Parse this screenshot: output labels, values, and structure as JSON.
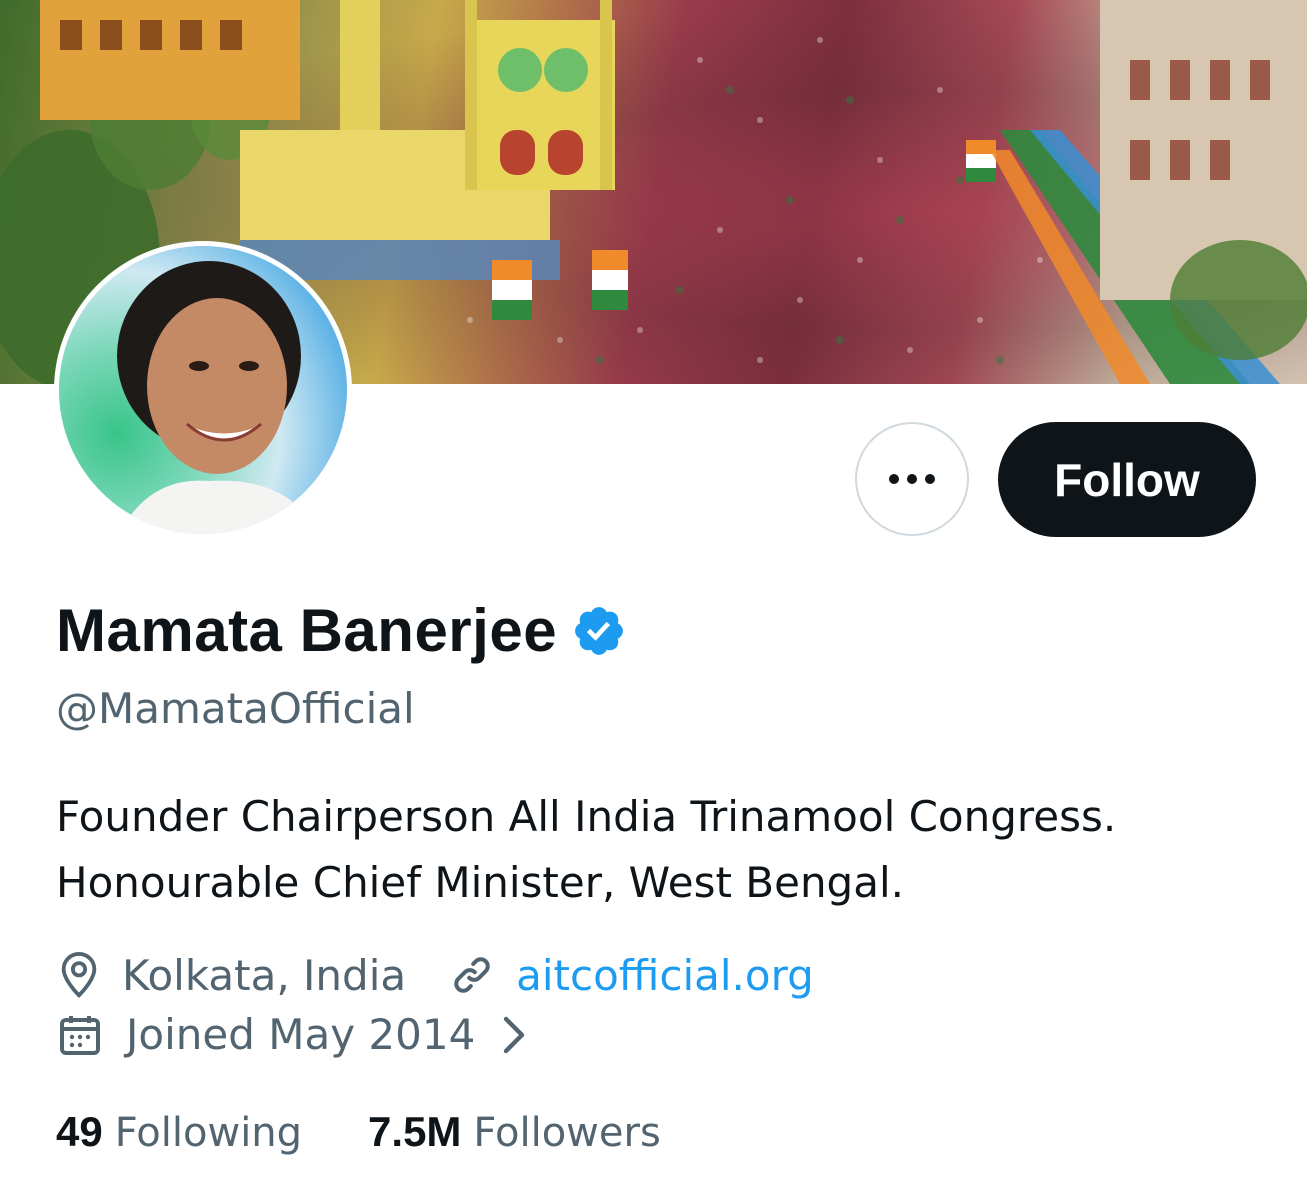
{
  "profile": {
    "display_name": "Mamata Banerjee",
    "handle": "@MamataOfficial",
    "verified": true,
    "bio_lines": [
      "Founder Chairperson All India Trinamool Congress.",
      "Honourable Chief Minister, West Bengal."
    ],
    "location": "Kolkata, India",
    "website": "aitcofficial.org",
    "joined": "Joined May 2014",
    "following_count": "49",
    "following_label": "Following",
    "followers_count": "7.5M",
    "followers_label": "Followers"
  },
  "actions": {
    "more_icon": "more-horizontal-icon",
    "follow_label": "Follow"
  },
  "colors": {
    "text_primary": "#0f1419",
    "text_secondary": "#536471",
    "link": "#1d9bf0",
    "verified_badge": "#1d9bf0",
    "follow_button_bg": "#0f1419"
  },
  "icons": {
    "location": "location-pin-icon",
    "website": "link-icon",
    "joined": "calendar-icon",
    "joined_chevron": "chevron-right-icon",
    "verified": "verified-badge-icon"
  }
}
